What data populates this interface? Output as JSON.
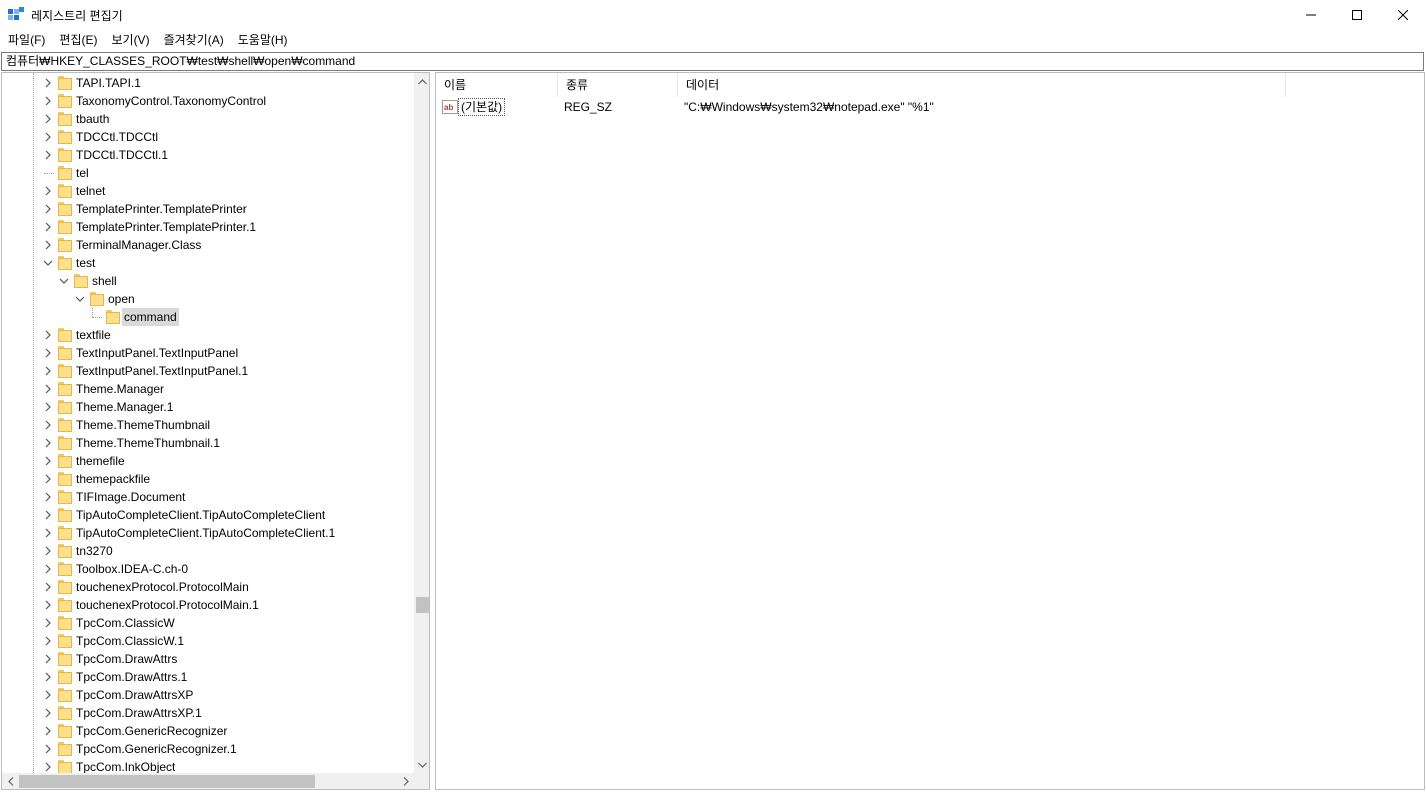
{
  "window": {
    "title": "레지스트리 편집기"
  },
  "menu": [
    {
      "label": "파일(F)"
    },
    {
      "label": "편집(E)"
    },
    {
      "label": "보기(V)"
    },
    {
      "label": "즐겨찾기(A)"
    },
    {
      "label": "도움말(H)"
    }
  ],
  "address": "컴퓨터₩HKEY_CLASSES_ROOT₩test₩shell₩open₩command",
  "tree": {
    "items": [
      {
        "label": "TAPI.TAPI.1",
        "level": 0,
        "expander": "collapsed"
      },
      {
        "label": "TaxonomyControl.TaxonomyControl",
        "level": 0,
        "expander": "collapsed"
      },
      {
        "label": "tbauth",
        "level": 0,
        "expander": "collapsed"
      },
      {
        "label": "TDCCtl.TDCCtl",
        "level": 0,
        "expander": "collapsed"
      },
      {
        "label": "TDCCtl.TDCCtl.1",
        "level": 0,
        "expander": "collapsed"
      },
      {
        "label": "tel",
        "level": 0,
        "expander": "none"
      },
      {
        "label": "telnet",
        "level": 0,
        "expander": "collapsed"
      },
      {
        "label": "TemplatePrinter.TemplatePrinter",
        "level": 0,
        "expander": "collapsed"
      },
      {
        "label": "TemplatePrinter.TemplatePrinter.1",
        "level": 0,
        "expander": "collapsed"
      },
      {
        "label": "TerminalManager.Class",
        "level": 0,
        "expander": "collapsed"
      },
      {
        "label": "test",
        "level": 0,
        "expander": "expanded"
      },
      {
        "label": "shell",
        "level": 1,
        "expander": "expanded"
      },
      {
        "label": "open",
        "level": 2,
        "expander": "expanded"
      },
      {
        "label": "command",
        "level": 3,
        "expander": "none",
        "selected": true
      },
      {
        "label": "textfile",
        "level": 0,
        "expander": "collapsed"
      },
      {
        "label": "TextInputPanel.TextInputPanel",
        "level": 0,
        "expander": "collapsed"
      },
      {
        "label": "TextInputPanel.TextInputPanel.1",
        "level": 0,
        "expander": "collapsed"
      },
      {
        "label": "Theme.Manager",
        "level": 0,
        "expander": "collapsed"
      },
      {
        "label": "Theme.Manager.1",
        "level": 0,
        "expander": "collapsed"
      },
      {
        "label": "Theme.ThemeThumbnail",
        "level": 0,
        "expander": "collapsed"
      },
      {
        "label": "Theme.ThemeThumbnail.1",
        "level": 0,
        "expander": "collapsed"
      },
      {
        "label": "themefile",
        "level": 0,
        "expander": "collapsed"
      },
      {
        "label": "themepackfile",
        "level": 0,
        "expander": "collapsed"
      },
      {
        "label": "TIFImage.Document",
        "level": 0,
        "expander": "collapsed"
      },
      {
        "label": "TipAutoCompleteClient.TipAutoCompleteClient",
        "level": 0,
        "expander": "collapsed"
      },
      {
        "label": "TipAutoCompleteClient.TipAutoCompleteClient.1",
        "level": 0,
        "expander": "collapsed"
      },
      {
        "label": "tn3270",
        "level": 0,
        "expander": "collapsed"
      },
      {
        "label": "Toolbox.IDEA-C.ch-0",
        "level": 0,
        "expander": "collapsed"
      },
      {
        "label": "touchenexProtocol.ProtocolMain",
        "level": 0,
        "expander": "collapsed"
      },
      {
        "label": "touchenexProtocol.ProtocolMain.1",
        "level": 0,
        "expander": "collapsed"
      },
      {
        "label": "TpcCom.ClassicW",
        "level": 0,
        "expander": "collapsed"
      },
      {
        "label": "TpcCom.ClassicW.1",
        "level": 0,
        "expander": "collapsed"
      },
      {
        "label": "TpcCom.DrawAttrs",
        "level": 0,
        "expander": "collapsed"
      },
      {
        "label": "TpcCom.DrawAttrs.1",
        "level": 0,
        "expander": "collapsed"
      },
      {
        "label": "TpcCom.DrawAttrsXP",
        "level": 0,
        "expander": "collapsed"
      },
      {
        "label": "TpcCom.DrawAttrsXP.1",
        "level": 0,
        "expander": "collapsed"
      },
      {
        "label": "TpcCom.GenericRecognizer",
        "level": 0,
        "expander": "collapsed"
      },
      {
        "label": "TpcCom.GenericRecognizer.1",
        "level": 0,
        "expander": "collapsed"
      },
      {
        "label": "TpcCom.InkObject",
        "level": 0,
        "expander": "collapsed"
      }
    ],
    "vertical_scroll_position": 0.78,
    "horizontal_scroll_position": 0.0
  },
  "list": {
    "columns": [
      {
        "label": "이름"
      },
      {
        "label": "종류"
      },
      {
        "label": "데이터"
      }
    ],
    "rows": [
      {
        "name": "(기본값)",
        "type": "REG_SZ",
        "data": "\"C:₩Windows₩system32₩notepad.exe\" \"%1\"",
        "icon": "string-value-icon"
      }
    ]
  },
  "colors": {
    "folder": "#ffe08a",
    "selection": "#d9d9d9",
    "scrollbar": "#f0f0f0",
    "value_icon": "#c0392b"
  }
}
